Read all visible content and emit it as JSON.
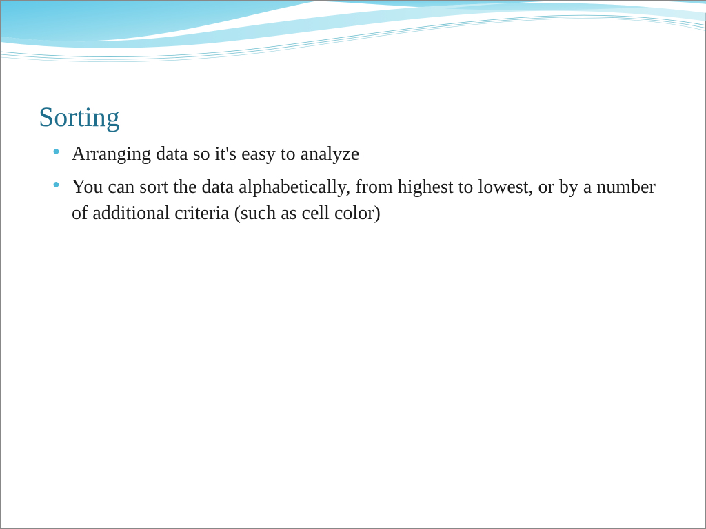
{
  "slide": {
    "title": "Sorting",
    "bullets": [
      "Arranging data so it's easy to analyze",
      "You can sort the data alphabetically, from highest to lowest, or by a number of additional criteria (such as cell color)"
    ]
  },
  "theme": {
    "titleColor": "#1f6e8c",
    "bulletColor": "#4db8d8",
    "textColor": "#1a1a1a"
  }
}
